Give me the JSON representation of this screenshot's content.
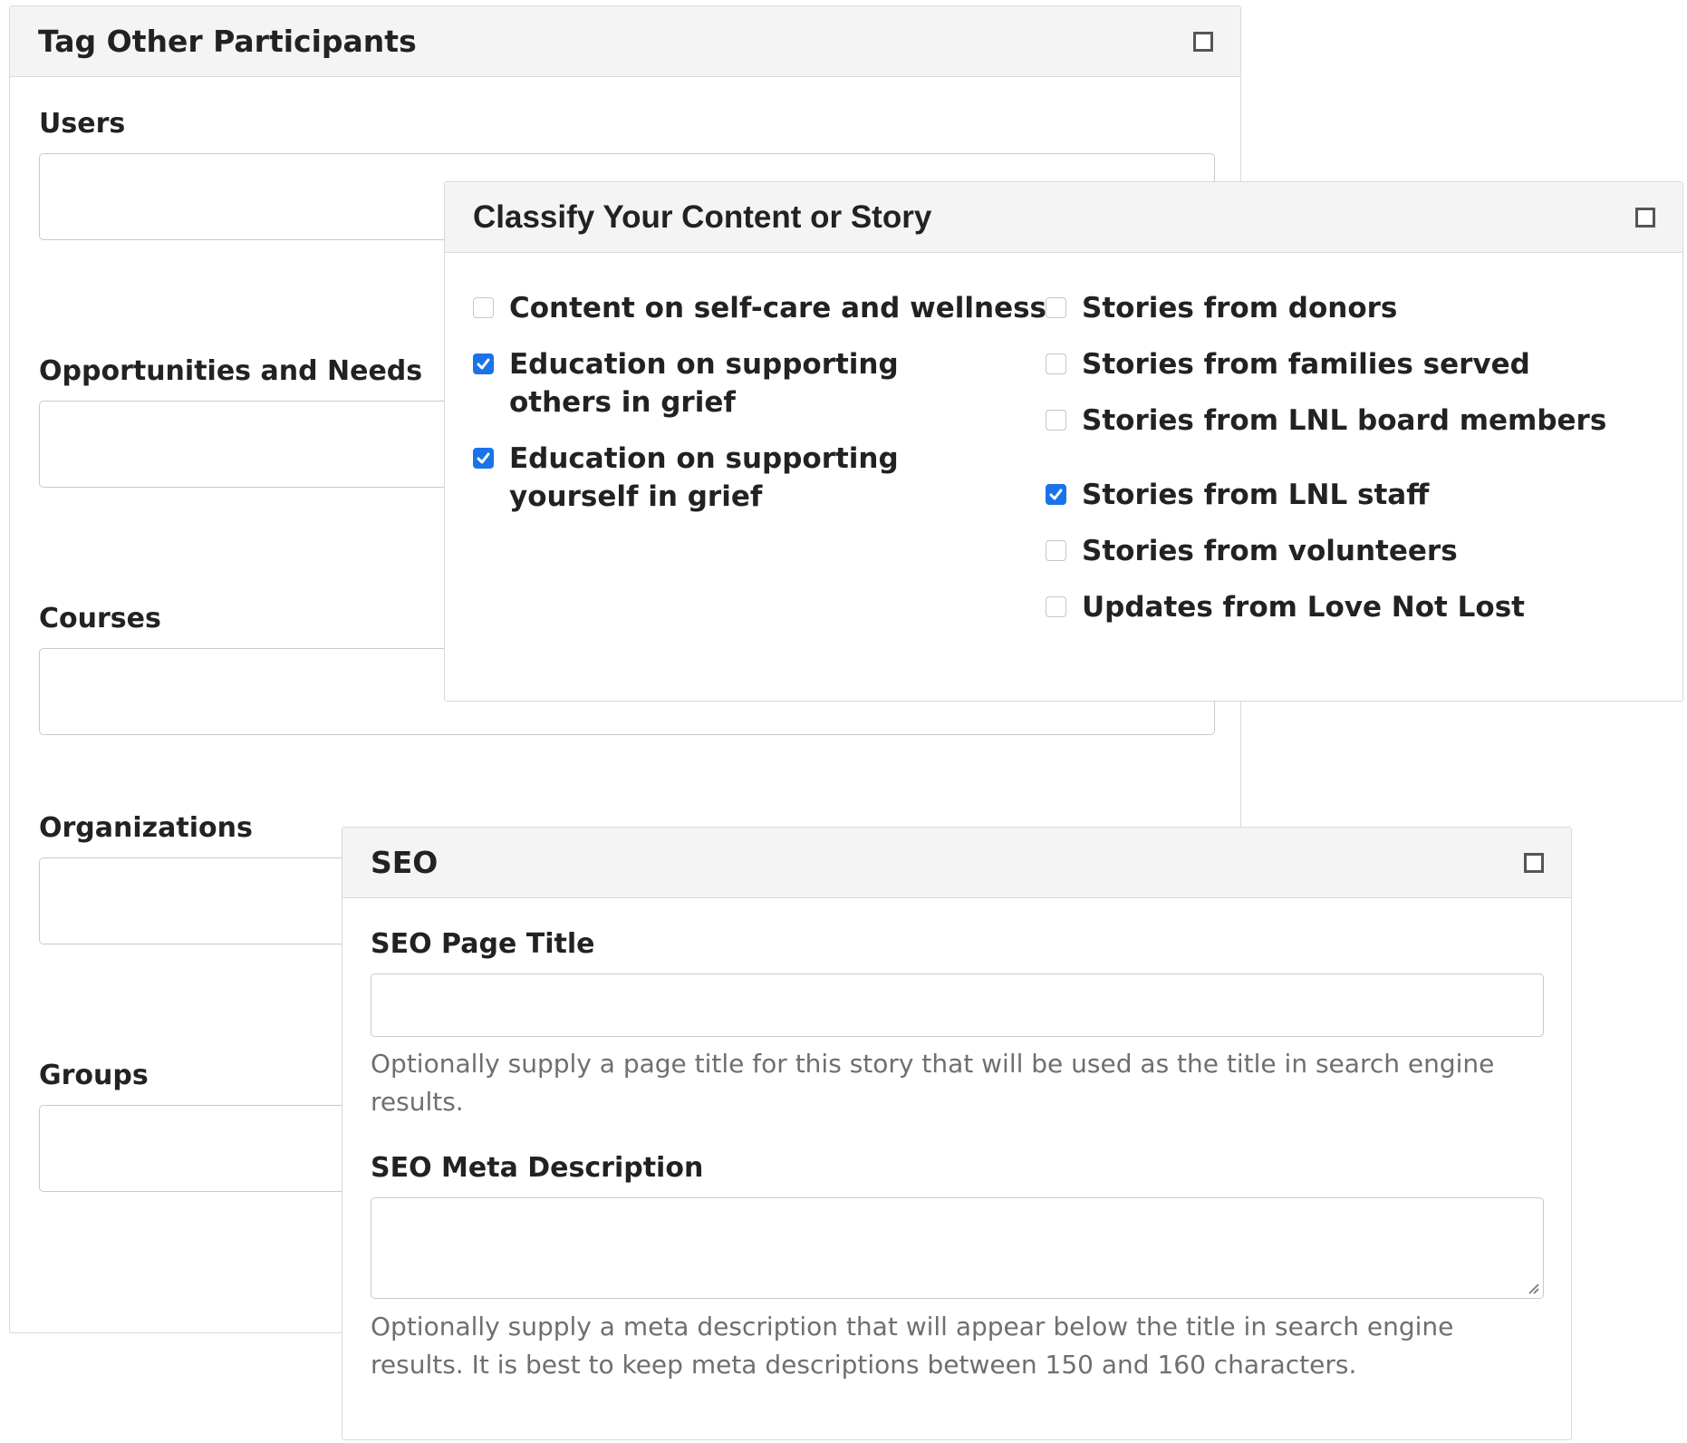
{
  "tag_panel": {
    "title": "Tag Other Participants",
    "fields": {
      "users": "Users",
      "opportunities": "Opportunities and Needs",
      "courses": "Courses",
      "organizations": "Organizations",
      "groups": "Groups"
    }
  },
  "classify_panel": {
    "title": "Classify Your Content or Story",
    "left_options": [
      {
        "label": "Content on self-care and wellness",
        "checked": false
      },
      {
        "label": "Education on supporting others in grief",
        "checked": true
      },
      {
        "label": "Education on supporting yourself in grief",
        "checked": true
      }
    ],
    "right_options": [
      {
        "label": "Stories from donors",
        "checked": false
      },
      {
        "label": "Stories from families served",
        "checked": false
      },
      {
        "label": "Stories from LNL board members",
        "checked": false
      },
      {
        "label": "Stories from LNL staff",
        "checked": true
      },
      {
        "label": "Stories from volunteers",
        "checked": false
      },
      {
        "label": "Updates from Love Not Lost",
        "checked": false
      }
    ]
  },
  "seo_panel": {
    "title": "SEO",
    "page_title_label": "SEO Page Title",
    "page_title_value": "",
    "page_title_help": "Optionally supply a page title for this story that will be used as the title in search engine results.",
    "meta_label": "SEO Meta Description",
    "meta_value": "",
    "meta_help": "Optionally supply a meta description that will appear below the title in search engine results. It is best to keep meta descriptions between 150 and 160 characters."
  },
  "colors": {
    "accent": "#1a73e8",
    "header_bg": "#f4f4f4",
    "help_text": "#6f6f6f"
  }
}
